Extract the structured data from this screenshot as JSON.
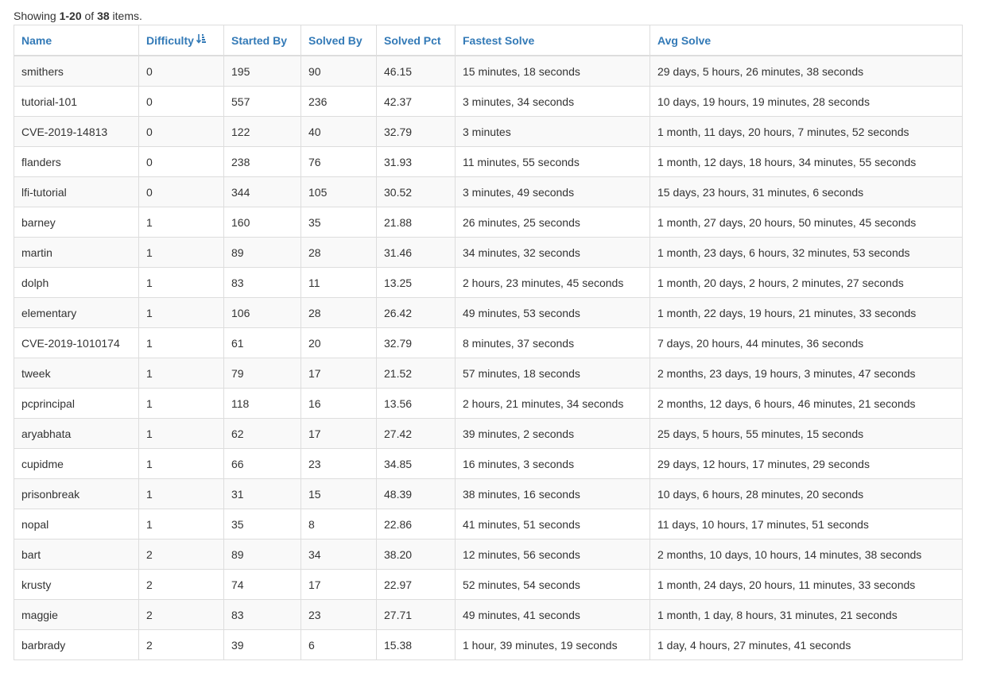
{
  "summary": {
    "prefix": "Showing ",
    "range": "1-20",
    "middle": " of ",
    "total": "38",
    "suffix": " items."
  },
  "table": {
    "columns": [
      "Name",
      "Difficulty",
      "Started By",
      "Solved By",
      "Solved Pct",
      "Fastest Solve",
      "Avg Solve"
    ],
    "sort": {
      "column": "Difficulty",
      "direction": "ascending",
      "icon": "sort-amount-asc-icon"
    },
    "rows": [
      [
        "smithers",
        "0",
        "195",
        "90",
        "46.15",
        "15 minutes, 18 seconds",
        "29 days, 5 hours, 26 minutes, 38 seconds"
      ],
      [
        "tutorial-101",
        "0",
        "557",
        "236",
        "42.37",
        "3 minutes, 34 seconds",
        "10 days, 19 hours, 19 minutes, 28 seconds"
      ],
      [
        "CVE-2019-14813",
        "0",
        "122",
        "40",
        "32.79",
        "3 minutes",
        "1 month, 11 days, 20 hours, 7 minutes, 52 seconds"
      ],
      [
        "flanders",
        "0",
        "238",
        "76",
        "31.93",
        "11 minutes, 55 seconds",
        "1 month, 12 days, 18 hours, 34 minutes, 55 seconds"
      ],
      [
        "lfi-tutorial",
        "0",
        "344",
        "105",
        "30.52",
        "3 minutes, 49 seconds",
        "15 days, 23 hours, 31 minutes, 6 seconds"
      ],
      [
        "barney",
        "1",
        "160",
        "35",
        "21.88",
        "26 minutes, 25 seconds",
        "1 month, 27 days, 20 hours, 50 minutes, 45 seconds"
      ],
      [
        "martin",
        "1",
        "89",
        "28",
        "31.46",
        "34 minutes, 32 seconds",
        "1 month, 23 days, 6 hours, 32 minutes, 53 seconds"
      ],
      [
        "dolph",
        "1",
        "83",
        "11",
        "13.25",
        "2 hours, 23 minutes, 45 seconds",
        "1 month, 20 days, 2 hours, 2 minutes, 27 seconds"
      ],
      [
        "elementary",
        "1",
        "106",
        "28",
        "26.42",
        "49 minutes, 53 seconds",
        "1 month, 22 days, 19 hours, 21 minutes, 33 seconds"
      ],
      [
        "CVE-2019-1010174",
        "1",
        "61",
        "20",
        "32.79",
        "8 minutes, 37 seconds",
        "7 days, 20 hours, 44 minutes, 36 seconds"
      ],
      [
        "tweek",
        "1",
        "79",
        "17",
        "21.52",
        "57 minutes, 18 seconds",
        "2 months, 23 days, 19 hours, 3 minutes, 47 seconds"
      ],
      [
        "pcprincipal",
        "1",
        "118",
        "16",
        "13.56",
        "2 hours, 21 minutes, 34 seconds",
        "2 months, 12 days, 6 hours, 46 minutes, 21 seconds"
      ],
      [
        "aryabhata",
        "1",
        "62",
        "17",
        "27.42",
        "39 minutes, 2 seconds",
        "25 days, 5 hours, 55 minutes, 15 seconds"
      ],
      [
        "cupidme",
        "1",
        "66",
        "23",
        "34.85",
        "16 minutes, 3 seconds",
        "29 days, 12 hours, 17 minutes, 29 seconds"
      ],
      [
        "prisonbreak",
        "1",
        "31",
        "15",
        "48.39",
        "38 minutes, 16 seconds",
        "10 days, 6 hours, 28 minutes, 20 seconds"
      ],
      [
        "nopal",
        "1",
        "35",
        "8",
        "22.86",
        "41 minutes, 51 seconds",
        "11 days, 10 hours, 17 minutes, 51 seconds"
      ],
      [
        "bart",
        "2",
        "89",
        "34",
        "38.20",
        "12 minutes, 56 seconds",
        "2 months, 10 days, 10 hours, 14 minutes, 38 seconds"
      ],
      [
        "krusty",
        "2",
        "74",
        "17",
        "22.97",
        "52 minutes, 54 seconds",
        "1 month, 24 days, 20 hours, 11 minutes, 33 seconds"
      ],
      [
        "maggie",
        "2",
        "83",
        "23",
        "27.71",
        "49 minutes, 41 seconds",
        "1 month, 1 day, 8 hours, 31 minutes, 21 seconds"
      ],
      [
        "barbrady",
        "2",
        "39",
        "6",
        "15.38",
        "1 hour, 39 minutes, 19 seconds",
        "1 day, 4 hours, 27 minutes, 41 seconds"
      ]
    ]
  },
  "colors": {
    "link": "#337ab7",
    "text": "#333333",
    "border": "#dddddd",
    "stripe": "#f9f9f9"
  }
}
